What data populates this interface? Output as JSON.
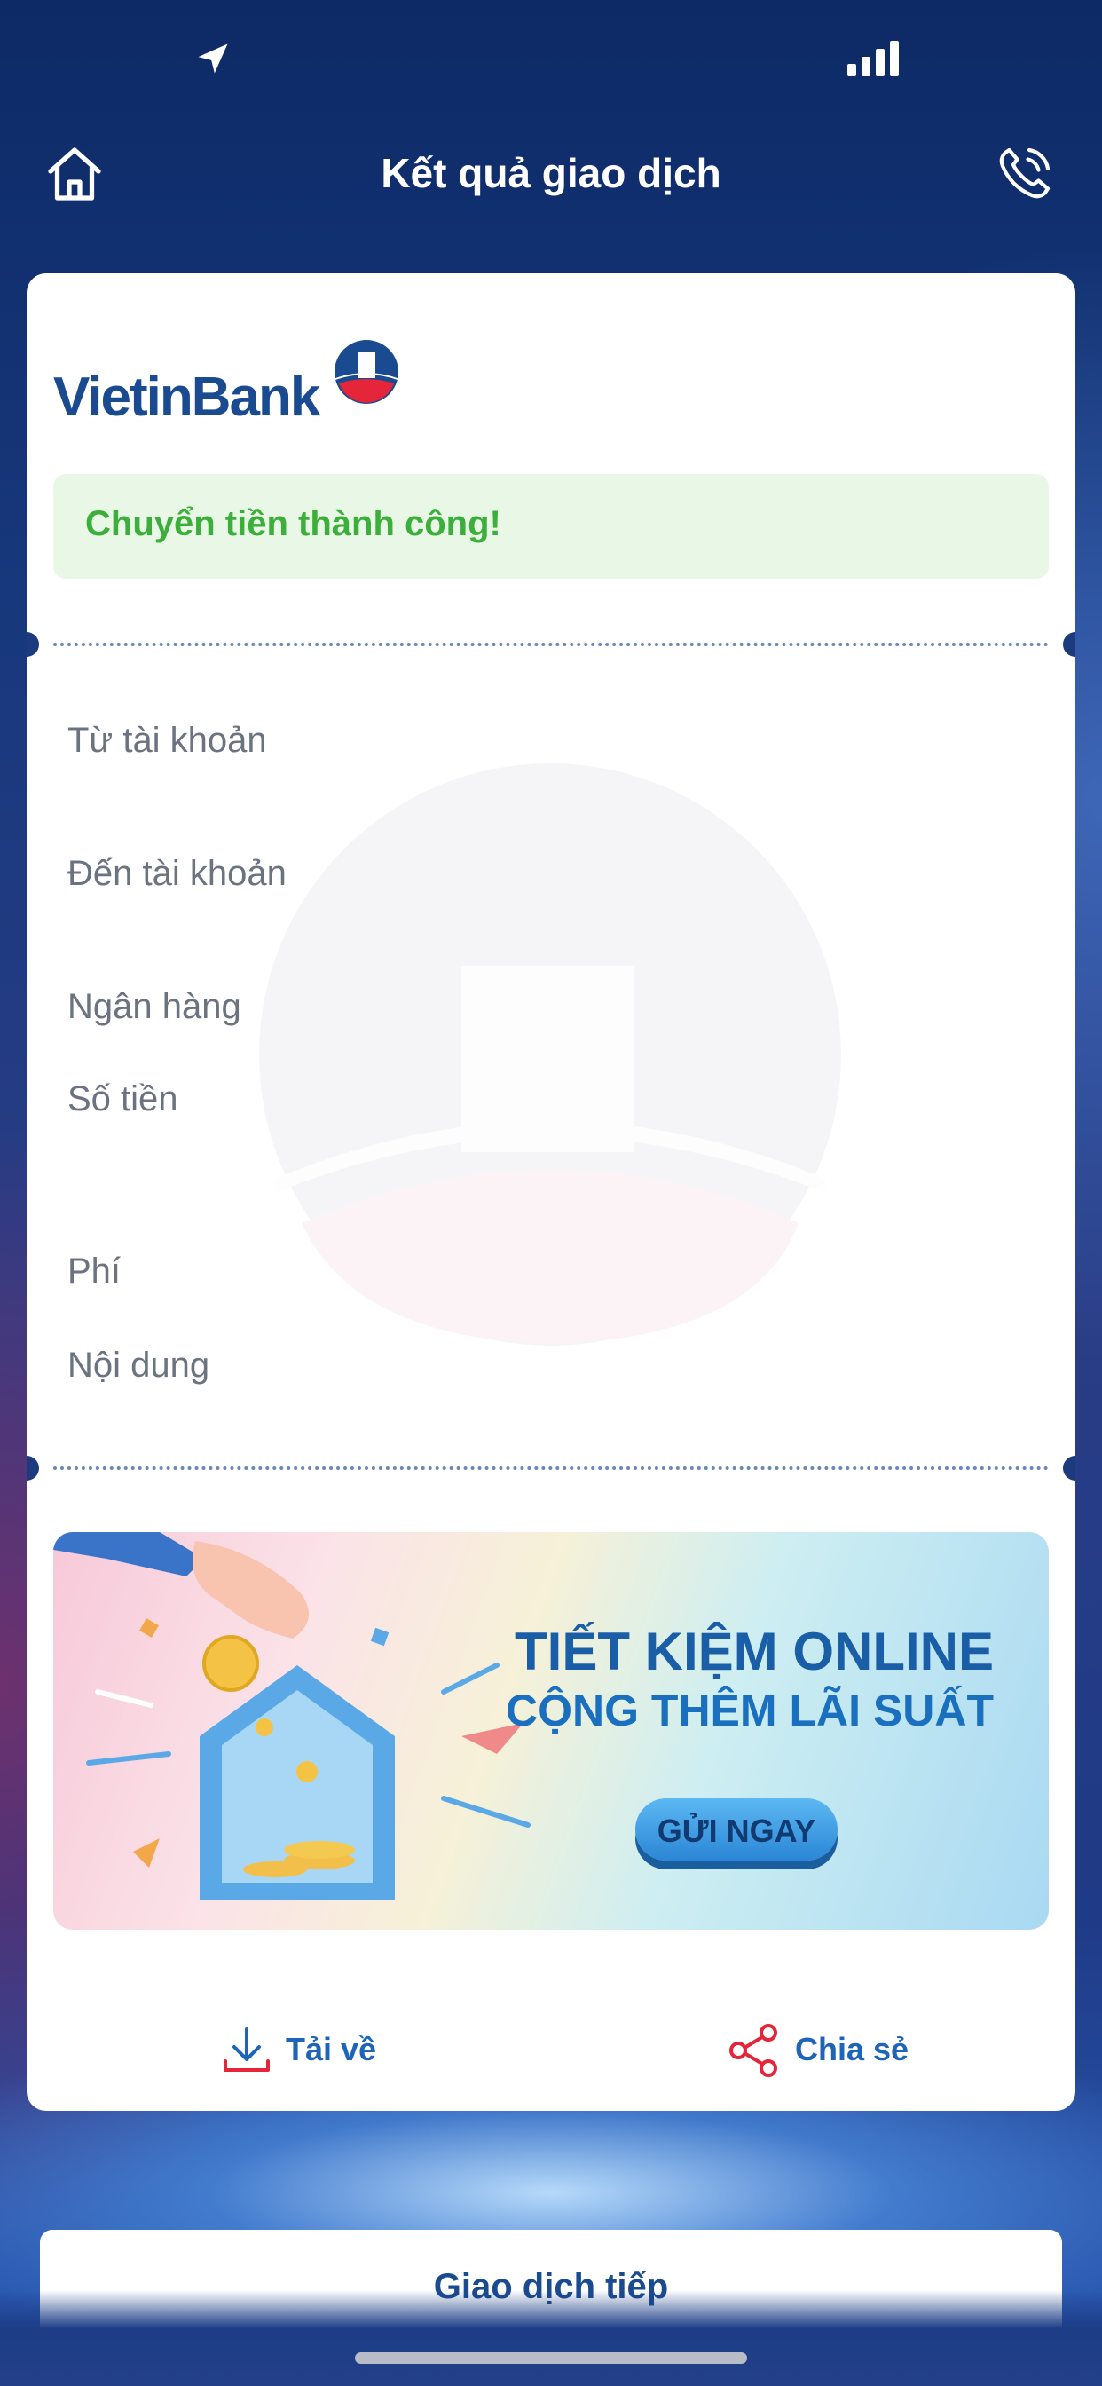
{
  "status_bar": {
    "location_icon": "location-arrow-icon",
    "signal_icon": "cellular-signal-icon"
  },
  "header": {
    "title": "Kết quả giao dịch",
    "home_icon": "home-icon",
    "phone_icon": "phone-call-icon"
  },
  "card": {
    "logo": "VietinBank",
    "success_message": "Chuyển tiền thành công!",
    "details": {
      "from_account_label": "Từ tài khoản",
      "to_account_label": "Đến tài khoản",
      "bank_label": "Ngân hàng",
      "amount_label": "Số tiền",
      "fee_label": "Phí",
      "content_label": "Nội dung"
    },
    "banner": {
      "title_line1": "TIẾT KIỆM ONLINE",
      "title_line2": "CỘNG THÊM LÃI SUẤT",
      "button_label": "GỬI NGAY"
    },
    "actions": {
      "download_label": "Tải về",
      "download_icon": "download-icon",
      "share_label": "Chia sẻ",
      "share_icon": "share-icon"
    }
  },
  "next_transaction_label": "Giao dịch tiếp",
  "colors": {
    "brand": "#1a4a8f",
    "success": "#3cae3a",
    "action": "#1e64b8",
    "accent_red": "#e5253a"
  }
}
